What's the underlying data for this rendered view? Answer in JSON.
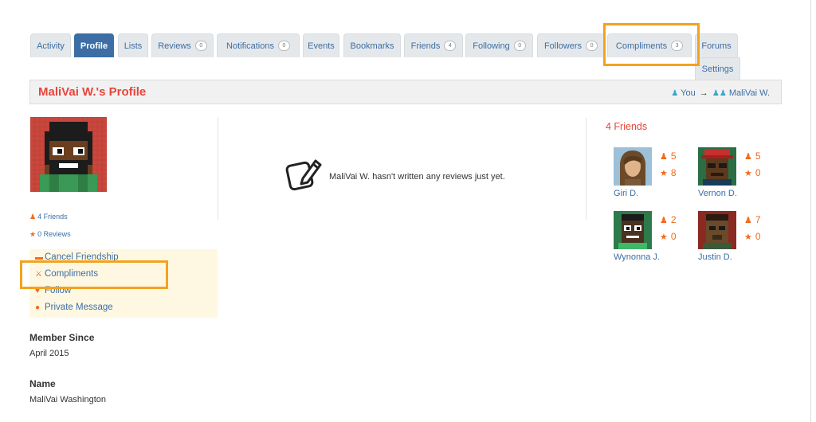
{
  "tabs": [
    {
      "label": "Activity"
    },
    {
      "label": "Profile"
    },
    {
      "label": "Lists"
    },
    {
      "label": "Reviews",
      "count": "0"
    },
    {
      "label": "Notifications",
      "count": "0"
    },
    {
      "label": "Events"
    },
    {
      "label": "Bookmarks"
    },
    {
      "label": "Friends",
      "count": "4"
    },
    {
      "label": "Following",
      "count": "0"
    },
    {
      "label": "Followers",
      "count": "0"
    },
    {
      "label": "Compliments",
      "count": "3"
    },
    {
      "label": "Forums"
    },
    {
      "label": "Settings"
    }
  ],
  "header": {
    "title": "MaliVai W.'s Profile",
    "crumb_you": "You",
    "crumb_arrow": "→",
    "crumb_user": "MaliVai W."
  },
  "stats": {
    "friends": "4 Friends",
    "reviews": "0 Reviews"
  },
  "actions": {
    "cancel_friendship": "Cancel Friendship",
    "compliments": "Compliments",
    "follow": "Follow",
    "private_message": "Private Message"
  },
  "meta": {
    "member_since_label": "Member Since",
    "member_since_value": "April 2015",
    "name_label": "Name",
    "name_value": "MaliVai Washington"
  },
  "empty": {
    "text": "MaliVai W. hasn't written any reviews just yet."
  },
  "friends": {
    "title": "4 Friends",
    "list": [
      {
        "name": "Giri D.",
        "friends": "5",
        "reviews": "8"
      },
      {
        "name": "Vernon D.",
        "friends": "5",
        "reviews": "0"
      },
      {
        "name": "Wynonna J.",
        "friends": "2",
        "reviews": "0"
      },
      {
        "name": "Justin D.",
        "friends": "7",
        "reviews": "0"
      }
    ]
  },
  "colors": {
    "accent": "#3c6ea5",
    "title_red": "#e5453c",
    "icon_orange": "#f26a1b",
    "highlight": "#f3a21f"
  }
}
